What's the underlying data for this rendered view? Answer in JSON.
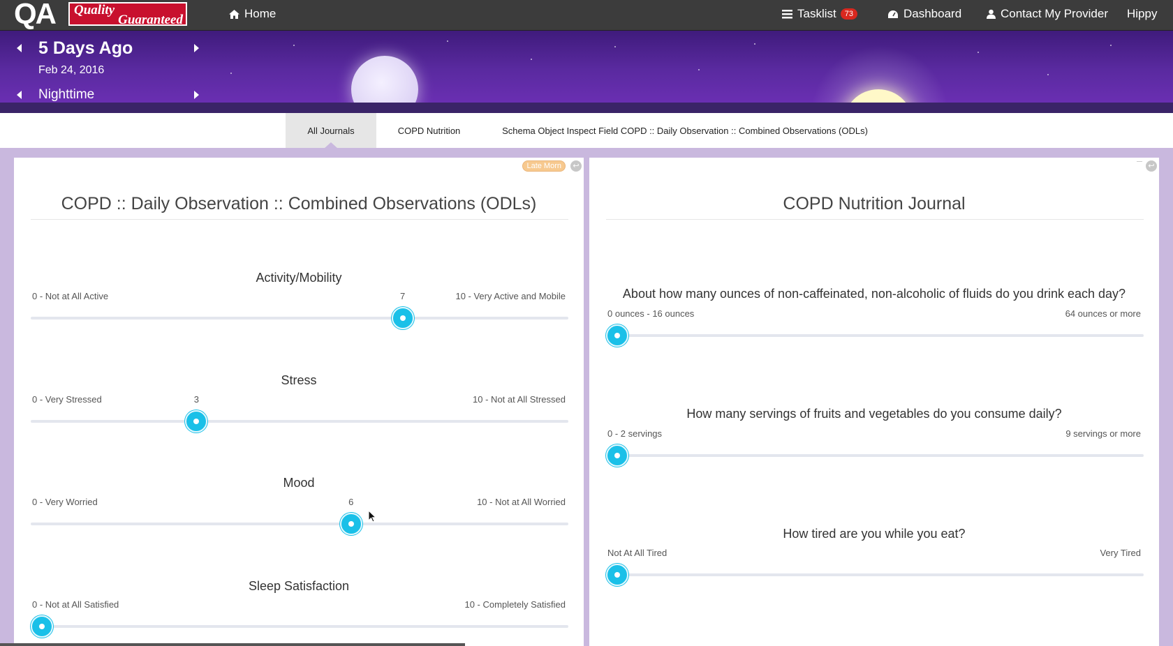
{
  "nav": {
    "logo": {
      "left": "QA",
      "line1": "Quality",
      "line2": "Guaranteed"
    },
    "home": "Home",
    "tasklist": "Tasklist",
    "tasklist_count": "73",
    "dashboard": "Dashboard",
    "contact": "Contact My Provider",
    "user": "Hippy"
  },
  "hero": {
    "relative_day": "5 Days Ago",
    "date": "Feb 24, 2016",
    "time_of_day": "Nighttime"
  },
  "tabs": [
    {
      "label": "All Journals",
      "active": true
    },
    {
      "label": "COPD Nutrition",
      "active": false
    },
    {
      "label": "Schema Object Inspect Field COPD :: Daily Observation :: Combined Observations (ODLs)",
      "active": false
    }
  ],
  "left_panel": {
    "title": "COPD :: Daily Observation :: Combined Observations (ODLs)",
    "badge": "Late Morn",
    "questions": [
      {
        "title": "Activity/Mobility",
        "min_label": "0 - Not at All Active",
        "max_label": "10 - Very Active and Mobile",
        "value": "7",
        "fraction": 0.7
      },
      {
        "title": "Stress",
        "min_label": "0 - Very Stressed",
        "max_label": "10 - Not at All Stressed",
        "value": "3",
        "fraction": 0.3
      },
      {
        "title": "Mood",
        "min_label": "0 - Very Worried",
        "max_label": "10 - Not at All Worried",
        "value": "6",
        "fraction": 0.6
      },
      {
        "title": "Sleep Satisfaction",
        "min_label": "0 - Not at All Satisfied",
        "max_label": "10 - Completely Satisfied",
        "value": "",
        "fraction": 0
      }
    ]
  },
  "right_panel": {
    "title": "COPD Nutrition Journal",
    "questions": [
      {
        "title": "About how many ounces of non-caffeinated, non-alcoholic of fluids do you drink each day?",
        "min_label": "0 ounces - 16 ounces",
        "max_label": "64 ounces or more",
        "fraction": 0
      },
      {
        "title": "How many servings of fruits and vegetables do you consume daily?",
        "min_label": "0 - 2 servings",
        "max_label": "9 servings or more",
        "fraction": 0
      },
      {
        "title": "How tired are you while you eat?",
        "min_label": "Not At All Tired",
        "max_label": "Very Tired",
        "fraction": 0
      }
    ]
  },
  "colors": {
    "accent": "#1ac0e8",
    "navbar": "#3c3c3c",
    "hero": "#5a2aa0",
    "badge": "#d9281f",
    "background": "#c9b8de"
  }
}
